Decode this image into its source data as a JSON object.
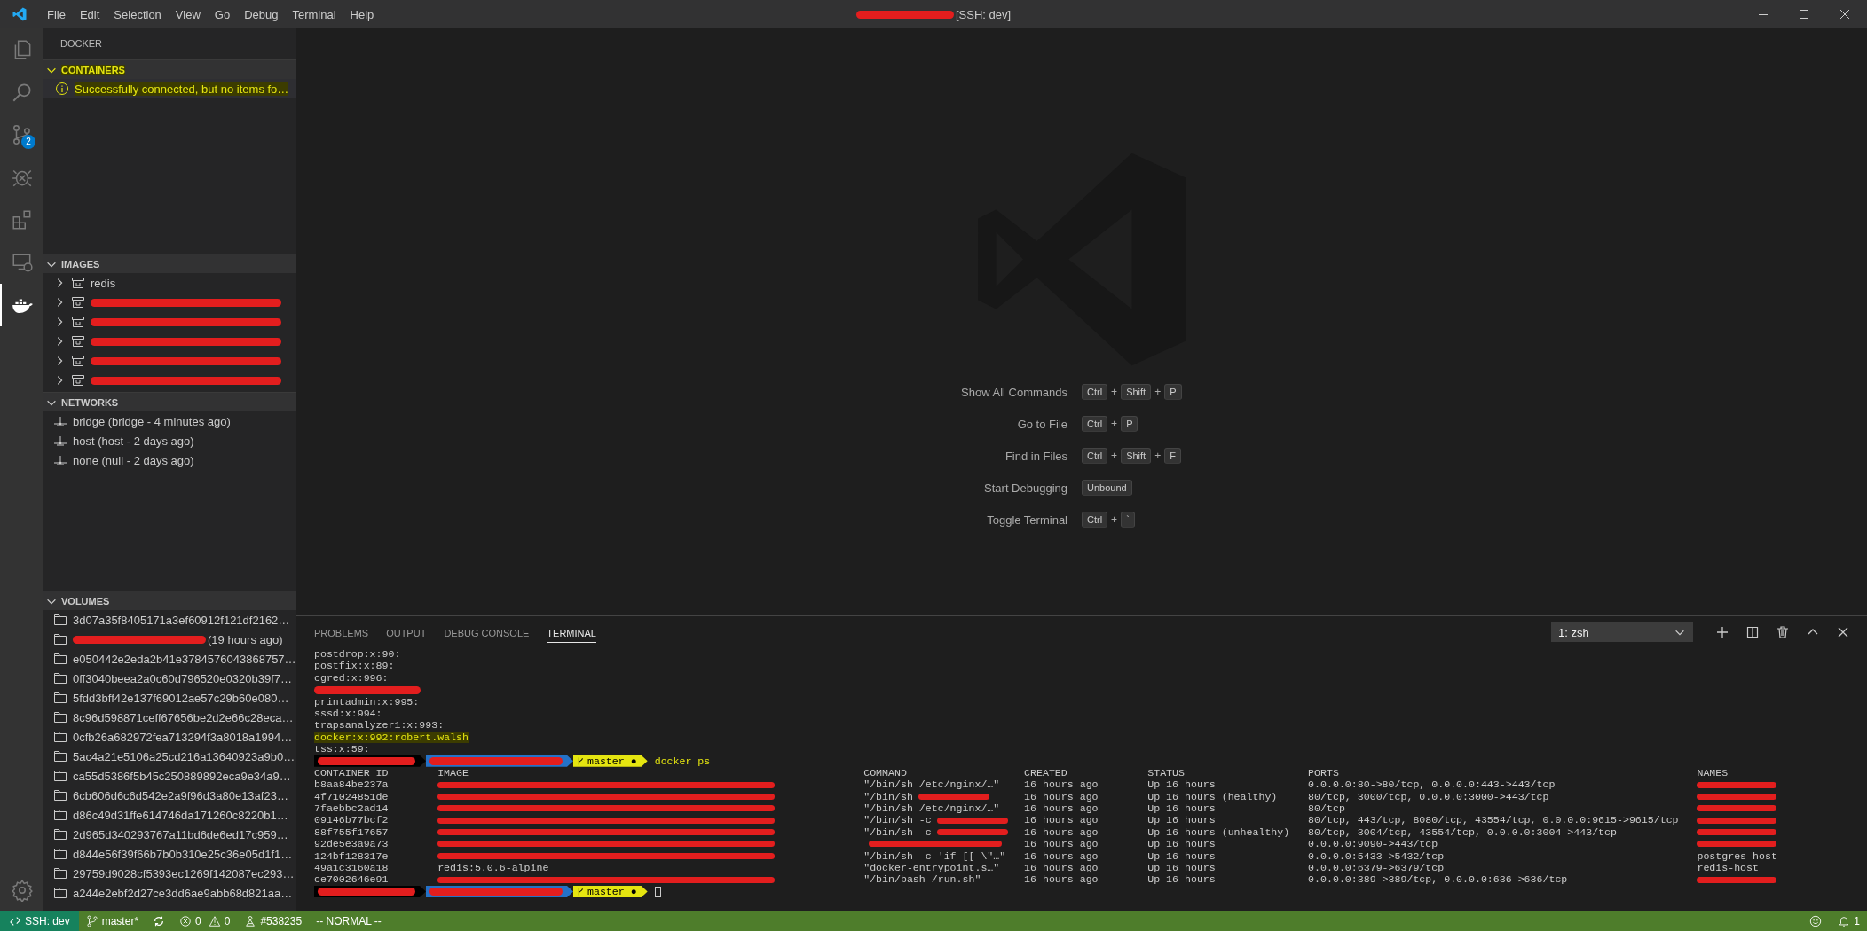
{
  "title_bar": {
    "menu": [
      "File",
      "Edit",
      "Selection",
      "View",
      "Go",
      "Debug",
      "Terminal",
      "Help"
    ],
    "title_redacted": true,
    "title": "[SSH: dev]"
  },
  "activity_bar": {
    "items": [
      {
        "kind": "files",
        "selected": false
      },
      {
        "kind": "search",
        "selected": false
      },
      {
        "kind": "source-control",
        "selected": false,
        "badge": "2"
      },
      {
        "kind": "debug",
        "selected": false
      },
      {
        "kind": "extensions",
        "selected": false
      },
      {
        "kind": "remote",
        "selected": false
      },
      {
        "kind": "docker",
        "selected": true
      }
    ],
    "bottom_items": [
      {
        "kind": "manage",
        "selected": false
      }
    ]
  },
  "sidebar": {
    "title": "DOCKER",
    "sections": [
      {
        "kind": "message",
        "title": "CONTAINERS",
        "expanded": true,
        "highlighted": true,
        "items": [
          {
            "label": "Successfully connected, but no items fo…",
            "redacted": false
          }
        ]
      },
      {
        "kind": "image",
        "title": "IMAGES",
        "expanded": true,
        "highlighted": false,
        "items": [
          {
            "label": "redis",
            "redacted": false,
            "expanded": false
          },
          {
            "redacted": true,
            "expanded": false
          },
          {
            "redacted": true,
            "expanded": false
          },
          {
            "redacted": true,
            "expanded": false
          },
          {
            "redacted": true,
            "expanded": false
          },
          {
            "redacted": true,
            "expanded": false
          }
        ]
      },
      {
        "kind": "network",
        "title": "NETWORKS",
        "expanded": true,
        "highlighted": false,
        "items": [
          {
            "label": "bridge (bridge - 4 minutes ago)",
            "redacted": false
          },
          {
            "label": "host (host - 2 days ago)",
            "redacted": false
          },
          {
            "label": "none (null - 2 days ago)",
            "redacted": false
          }
        ]
      },
      {
        "kind": "volume",
        "title": "VOLUMES",
        "expanded": true,
        "highlighted": false,
        "items": [
          {
            "label": "3d07a35f8405171a3ef60912f121df2162…",
            "redacted": false
          },
          {
            "label": "(19 hours ago)",
            "redacted": true
          },
          {
            "label": "e050442e2eda2b41e3784576043868757…",
            "redacted": false
          },
          {
            "label": "0ff3040beea2a0c60d796520e0320b39f7…",
            "redacted": false
          },
          {
            "label": "5fdd3bff42e137f69012ae57c29b60e080…",
            "redacted": false
          },
          {
            "label": "8c96d598871ceff67656be2d2e66c28eca…",
            "redacted": false
          },
          {
            "label": "0cfb26a682972fea713294f3a8018a1994…",
            "redacted": false
          },
          {
            "label": "5ac4a21e5106a25cd216a13640923a9b0…",
            "redacted": false
          },
          {
            "label": "ca55d5386f5b45c250889892eca9e34a9…",
            "redacted": false
          },
          {
            "label": "6cb606d6c6d542e2a9f96d3a80e13af23…",
            "redacted": false
          },
          {
            "label": "d86c49d31ffe614746da171260c8220b1…",
            "redacted": false
          },
          {
            "label": "2d965d340293767a11bd6de6ed17c959…",
            "redacted": false
          },
          {
            "label": "d844e56f39f66b7b0b310e25c36e05d1f1…",
            "redacted": false
          },
          {
            "label": "29759d9028cf5393ec1269f142087ec293…",
            "redacted": false
          },
          {
            "label": "a244e2ebf2d27ce3dd6ae9abb68d821aa…",
            "redacted": false
          }
        ]
      }
    ]
  },
  "welcome": {
    "shortcuts": [
      {
        "label": "Show All Commands",
        "keys": [
          {
            "kind": "key",
            "text": "Ctrl"
          },
          {
            "kind": "plus",
            "text": "+"
          },
          {
            "kind": "key",
            "text": "Shift"
          },
          {
            "kind": "plus",
            "text": "+"
          },
          {
            "kind": "key",
            "text": "P"
          }
        ]
      },
      {
        "label": "Go to File",
        "keys": [
          {
            "kind": "key",
            "text": "Ctrl"
          },
          {
            "kind": "plus",
            "text": "+"
          },
          {
            "kind": "key",
            "text": "P"
          }
        ]
      },
      {
        "label": "Find in Files",
        "keys": [
          {
            "kind": "key",
            "text": "Ctrl"
          },
          {
            "kind": "plus",
            "text": "+"
          },
          {
            "kind": "key",
            "text": "Shift"
          },
          {
            "kind": "plus",
            "text": "+"
          },
          {
            "kind": "key",
            "text": "F"
          }
        ]
      },
      {
        "label": "Start Debugging",
        "keys": [
          {
            "kind": "key",
            "text": "Unbound"
          }
        ]
      },
      {
        "label": "Toggle Terminal",
        "keys": [
          {
            "kind": "key",
            "text": "Ctrl"
          },
          {
            "kind": "plus",
            "text": "+"
          },
          {
            "kind": "key",
            "text": "`"
          }
        ]
      }
    ]
  },
  "panel": {
    "tabs": [
      {
        "label": "PROBLEMS",
        "selected": false
      },
      {
        "label": "OUTPUT",
        "selected": false
      },
      {
        "label": "DEBUG CONSOLE",
        "selected": false
      },
      {
        "label": "TERMINAL",
        "selected": true
      }
    ],
    "terminal_select": "1: zsh",
    "lines": [
      {
        "kind": "text",
        "text": "postdrop:x:90:"
      },
      {
        "kind": "text",
        "text": "postfix:x:89:"
      },
      {
        "kind": "text",
        "text": "cgred:x:996:"
      },
      {
        "kind": "redacted"
      },
      {
        "kind": "text",
        "text": "printadmin:x:995:"
      },
      {
        "kind": "text",
        "text": "sssd:x:994:"
      },
      {
        "kind": "text",
        "text": "trapsanalyzer1:x:993:"
      },
      {
        "kind": "match",
        "text": "docker:x:992:robert.walsh"
      },
      {
        "kind": "text",
        "text": "tss:x:59:"
      },
      {
        "kind": "prompt",
        "branch": "master ●",
        "command": "docker ps"
      },
      {
        "kind": "table",
        "columns": [
          "CONTAINER ID",
          "IMAGE",
          "COMMAND",
          "CREATED",
          "STATUS",
          "PORTS",
          "NAMES"
        ],
        "rows": [
          {
            "cells": [
              {
                "kind": "text",
                "text": "b8aa84be237a"
              },
              {
                "kind": "redacted"
              },
              {
                "kind": "text",
                "text": "\"/bin/sh /etc/nginx/…\""
              },
              {
                "kind": "text",
                "text": "16 hours ago"
              },
              {
                "kind": "text",
                "text": "Up 16 hours"
              },
              {
                "kind": "text",
                "text": "0.0.0.0:80->80/tcp, 0.0.0.0:443->443/tcp"
              },
              {
                "kind": "redacted"
              }
            ]
          },
          {
            "cells": [
              {
                "kind": "text",
                "text": "4f71024851de"
              },
              {
                "kind": "redacted"
              },
              {
                "kind": "partial",
                "text": "\"/bin/sh"
              },
              {
                "kind": "text",
                "text": "16 hours ago"
              },
              {
                "kind": "text",
                "text": "Up 16 hours (healthy)"
              },
              {
                "kind": "text",
                "text": "80/tcp, 3000/tcp, 0.0.0.0:3000->443/tcp"
              },
              {
                "kind": "redacted"
              }
            ]
          },
          {
            "cells": [
              {
                "kind": "text",
                "text": "7faebbc2ad14"
              },
              {
                "kind": "redacted"
              },
              {
                "kind": "text",
                "text": "\"/bin/sh /etc/nginx/…\""
              },
              {
                "kind": "text",
                "text": "16 hours ago"
              },
              {
                "kind": "text",
                "text": "Up 16 hours"
              },
              {
                "kind": "text",
                "text": "80/tcp"
              },
              {
                "kind": "redacted"
              }
            ]
          },
          {
            "cells": [
              {
                "kind": "text",
                "text": "09146b77bcf2"
              },
              {
                "kind": "redacted"
              },
              {
                "kind": "partial",
                "text": "\"/bin/sh -c"
              },
              {
                "kind": "text",
                "text": "16 hours ago"
              },
              {
                "kind": "text",
                "text": "Up 16 hours"
              },
              {
                "kind": "text",
                "text": "80/tcp, 443/tcp, 8080/tcp, 43554/tcp, 0.0.0.0:9615->9615/tcp"
              },
              {
                "kind": "redacted"
              }
            ]
          },
          {
            "cells": [
              {
                "kind": "text",
                "text": "88f755f17657"
              },
              {
                "kind": "redacted"
              },
              {
                "kind": "partial",
                "text": "\"/bin/sh -c"
              },
              {
                "kind": "text",
                "text": "16 hours ago"
              },
              {
                "kind": "text",
                "text": "Up 16 hours (unhealthy)"
              },
              {
                "kind": "text",
                "text": "80/tcp, 3004/tcp, 43554/tcp, 0.0.0.0:3004->443/tcp"
              },
              {
                "kind": "redacted"
              }
            ]
          },
          {
            "cells": [
              {
                "kind": "text",
                "text": "92de5e3a9a73"
              },
              {
                "kind": "redacted"
              },
              {
                "kind": "redacted"
              },
              {
                "kind": "text",
                "text": "16 hours ago"
              },
              {
                "kind": "text",
                "text": "Up 16 hours"
              },
              {
                "kind": "text",
                "text": "0.0.0.0:9090->443/tcp"
              },
              {
                "kind": "redacted"
              }
            ]
          },
          {
            "cells": [
              {
                "kind": "text",
                "text": "124bf128317e"
              },
              {
                "kind": "redacted"
              },
              {
                "kind": "text",
                "text": "\"/bin/sh -c 'if [[ \\\"…\""
              },
              {
                "kind": "text",
                "text": "16 hours ago"
              },
              {
                "kind": "text",
                "text": "Up 16 hours"
              },
              {
                "kind": "text",
                "text": "0.0.0.0:5433->5432/tcp"
              },
              {
                "kind": "text",
                "text": "postgres-host"
              }
            ]
          },
          {
            "cells": [
              {
                "kind": "text",
                "text": "49a1c3160a18"
              },
              {
                "kind": "text",
                "text": "redis:5.0.6-alpine"
              },
              {
                "kind": "text",
                "text": "\"docker-entrypoint.s…\""
              },
              {
                "kind": "text",
                "text": "16 hours ago"
              },
              {
                "kind": "text",
                "text": "Up 16 hours"
              },
              {
                "kind": "text",
                "text": "0.0.0.0:6379->6379/tcp"
              },
              {
                "kind": "text",
                "text": "redis-host"
              }
            ]
          },
          {
            "cells": [
              {
                "kind": "text",
                "text": "ce7002646e91"
              },
              {
                "kind": "redacted"
              },
              {
                "kind": "text",
                "text": "\"/bin/bash /run.sh\""
              },
              {
                "kind": "text",
                "text": "16 hours ago"
              },
              {
                "kind": "text",
                "text": "Up 16 hours"
              },
              {
                "kind": "text",
                "text": "0.0.0.0:389->389/tcp, 0.0.0.0:636->636/tcp"
              },
              {
                "kind": "redacted"
              }
            ]
          }
        ]
      },
      {
        "kind": "prompt",
        "branch": "master ●",
        "cursor": true
      }
    ]
  },
  "status_bar": {
    "left": [
      {
        "kind": "remote",
        "text": "SSH: dev"
      },
      {
        "kind": "branch",
        "text": "master*"
      },
      {
        "kind": "sync"
      },
      {
        "kind": "problems",
        "errors": "0",
        "warnings": "0"
      },
      {
        "kind": "build",
        "text": "#538235"
      },
      {
        "kind": "mode",
        "text": "-- NORMAL --"
      }
    ],
    "right": [
      {
        "kind": "feedback"
      },
      {
        "kind": "notifications",
        "text": "1"
      }
    ]
  }
}
